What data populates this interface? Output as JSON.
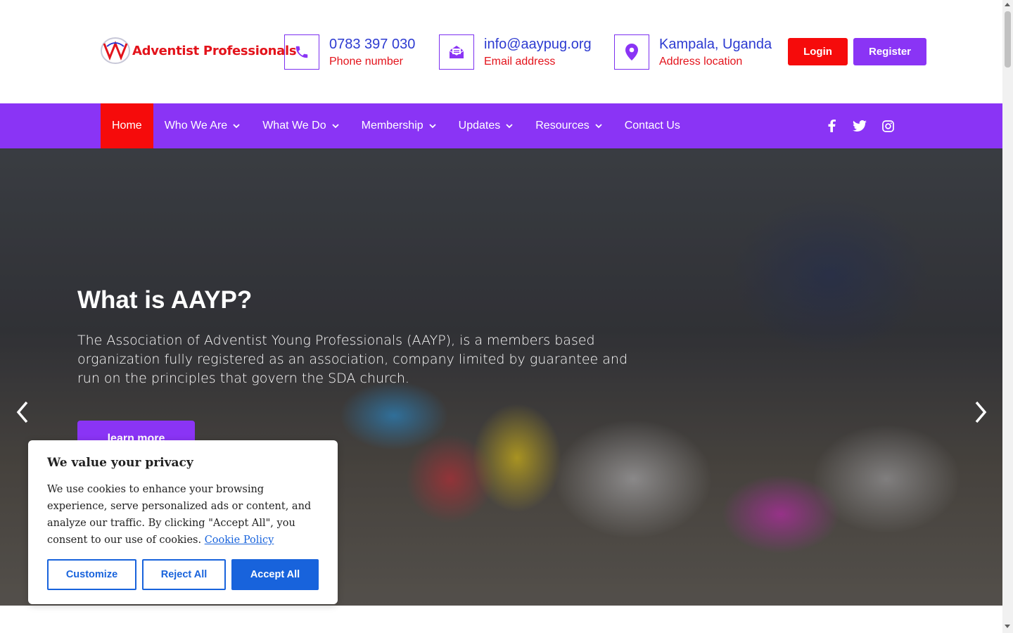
{
  "header": {
    "logo_text": "Adventist Professionals",
    "logo_mark": "AAYP",
    "contacts": [
      {
        "icon": "phone-icon",
        "main": "0783 397 030",
        "sub": "Phone number"
      },
      {
        "icon": "email-icon",
        "main": "info@aaypug.org",
        "sub": "Email address"
      },
      {
        "icon": "location-icon",
        "main": "Kampala, Uganda",
        "sub": "Address location"
      }
    ],
    "login_label": "Login",
    "register_label": "Register"
  },
  "nav": {
    "items": [
      {
        "label": "Home",
        "active": true,
        "dropdown": false
      },
      {
        "label": "Who We Are",
        "dropdown": true
      },
      {
        "label": "What We Do",
        "dropdown": true
      },
      {
        "label": "Membership",
        "dropdown": true
      },
      {
        "label": "Updates",
        "dropdown": true
      },
      {
        "label": "Resources",
        "dropdown": true
      },
      {
        "label": "Contact Us",
        "dropdown": false
      }
    ],
    "social": [
      "facebook-icon",
      "twitter-icon",
      "instagram-icon"
    ]
  },
  "hero": {
    "title": "What is AAYP?",
    "text": "The Association of Adventist Young Professionals (AAYP), is a members based organization fully registered as an association, company limited by guarantee and run on the principles that govern the SDA church.",
    "button_label": "learn more"
  },
  "cookie": {
    "title": "We value your privacy",
    "text": "We use cookies to enhance your browsing experience, serve personalized ads or content, and analyze our traffic. By clicking \"Accept All\", you consent to our use of cookies.",
    "link_label": "Cookie Policy",
    "customize_label": "Customize",
    "reject_label": "Reject All",
    "accept_label": "Accept All"
  },
  "colors": {
    "brand_purple": "#8a34f5",
    "brand_red": "#f60b0b",
    "link_blue": "#2d3bd1",
    "cookie_blue": "#1863dc"
  }
}
